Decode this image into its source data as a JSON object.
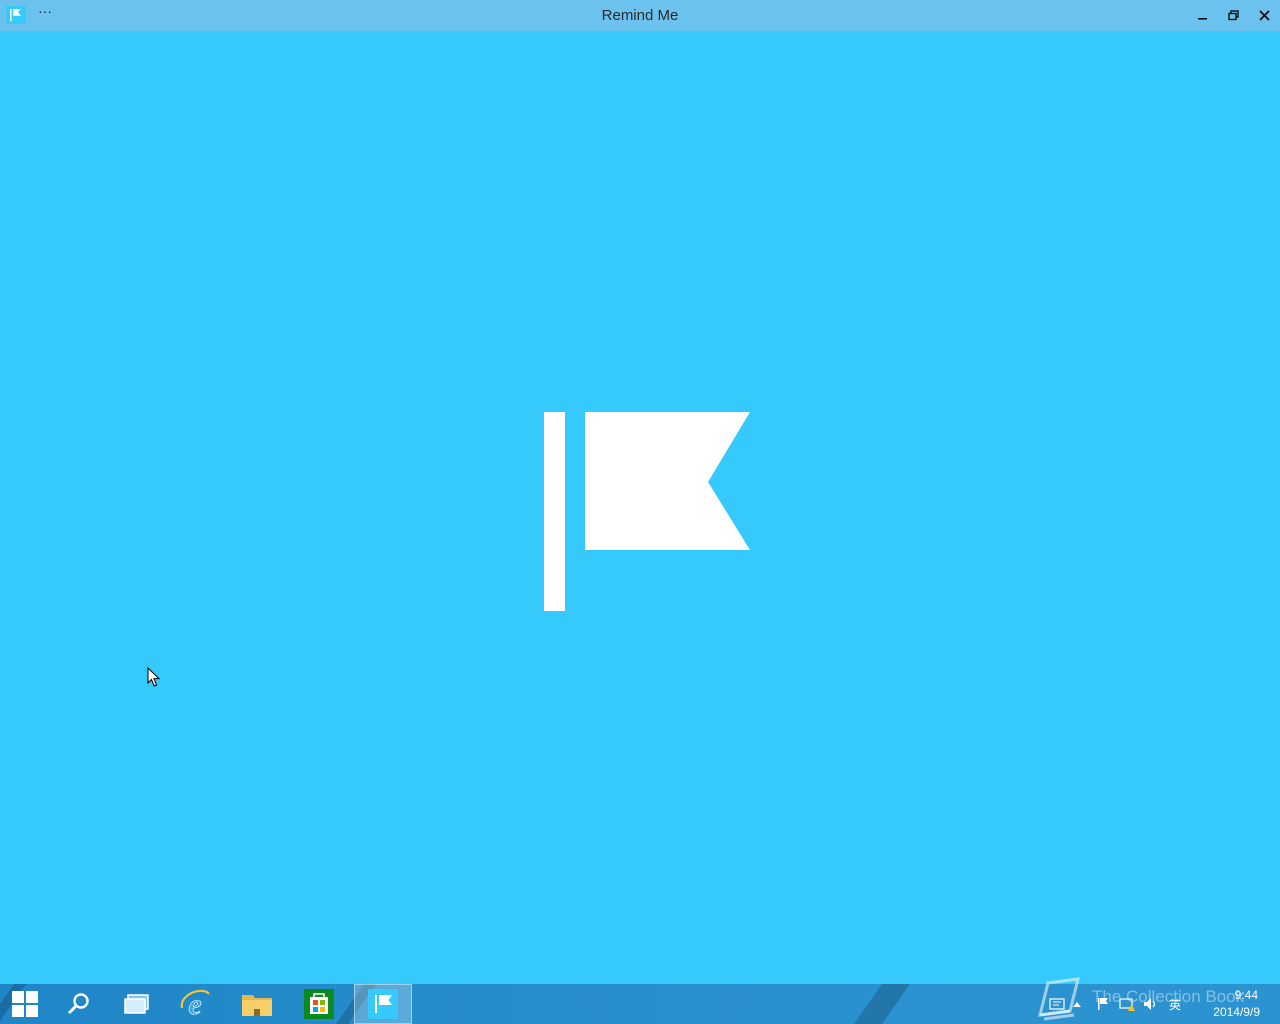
{
  "window": {
    "title": "Remind Me",
    "menu_glyph": "···",
    "app_icon": "flag-icon",
    "controls": [
      "minimize-icon",
      "restore-icon",
      "close-icon"
    ]
  },
  "splash": {
    "icon": "flag-icon",
    "background": "#36c9fb",
    "foreground": "#ffffff"
  },
  "taskbar": {
    "pinned": [
      {
        "name": "start",
        "icon": "windows-logo-icon"
      },
      {
        "name": "search",
        "icon": "search-icon"
      },
      {
        "name": "task-view",
        "icon": "task-view-icon"
      },
      {
        "name": "internet-explorer",
        "icon": "internet-explorer-icon"
      },
      {
        "name": "file-explorer",
        "icon": "folder-icon"
      },
      {
        "name": "store",
        "icon": "store-icon"
      },
      {
        "name": "remind-me",
        "icon": "flag-icon",
        "active": true
      }
    ],
    "tray": {
      "ime_label": "英",
      "time": "9:44",
      "date": "2014/9/9"
    },
    "watermark": "The Collection Book",
    "accent": "#2a91cf"
  }
}
